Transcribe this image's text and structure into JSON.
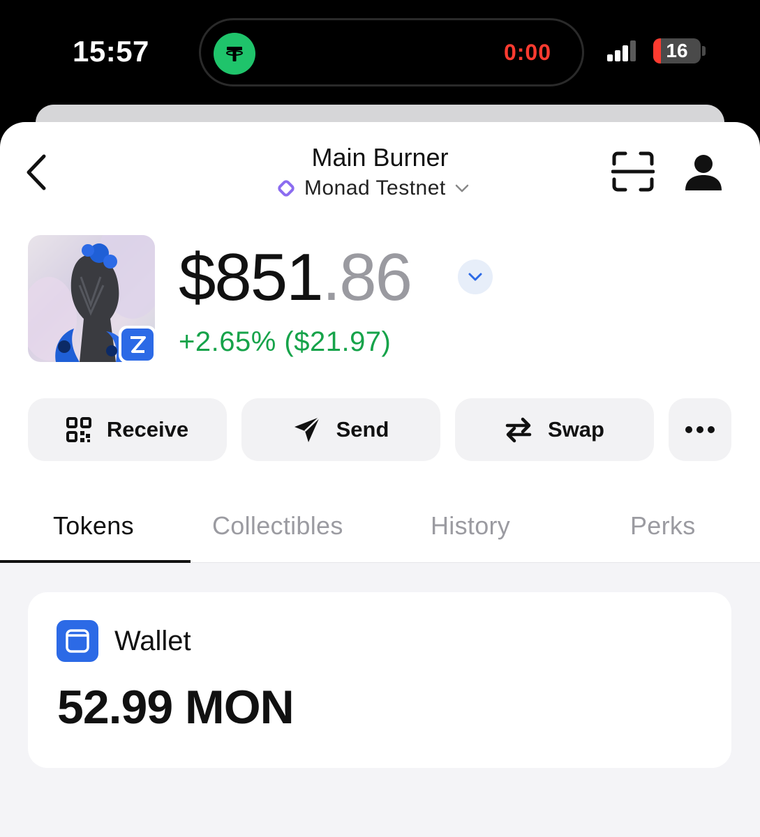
{
  "status_bar": {
    "time": "15:57",
    "live_activity_timer": "0:00",
    "battery_level": "16"
  },
  "header": {
    "wallet_name": "Main Burner",
    "network": "Monad Testnet"
  },
  "balance": {
    "integer_part": "$851",
    "decimal_part": ".86",
    "change": "+2.65% ($21.97)"
  },
  "actions": {
    "receive": "Receive",
    "send": "Send",
    "swap": "Swap"
  },
  "tabs": [
    {
      "label": "Tokens",
      "active": true
    },
    {
      "label": "Collectibles",
      "active": false
    },
    {
      "label": "History",
      "active": false
    },
    {
      "label": "Perks",
      "active": false
    }
  ],
  "wallet_card": {
    "label": "Wallet",
    "amount": "52.99 MON"
  },
  "colors": {
    "accent_blue": "#2c6ae6",
    "positive_green": "#16a34a",
    "tether_green": "#1fc46b",
    "timer_red": "#ff3b30",
    "network_purple": "#8b6cf0"
  },
  "icons": {
    "back": "chevron-left-icon",
    "network": "monad-logo-icon",
    "dropdown": "chevron-down-icon",
    "scan": "scan-icon",
    "profile": "person-icon",
    "receive": "qr-code-icon",
    "send": "paper-plane-icon",
    "swap": "swap-arrows-icon",
    "more": "more-dots-icon",
    "wallet": "wallet-icon"
  }
}
